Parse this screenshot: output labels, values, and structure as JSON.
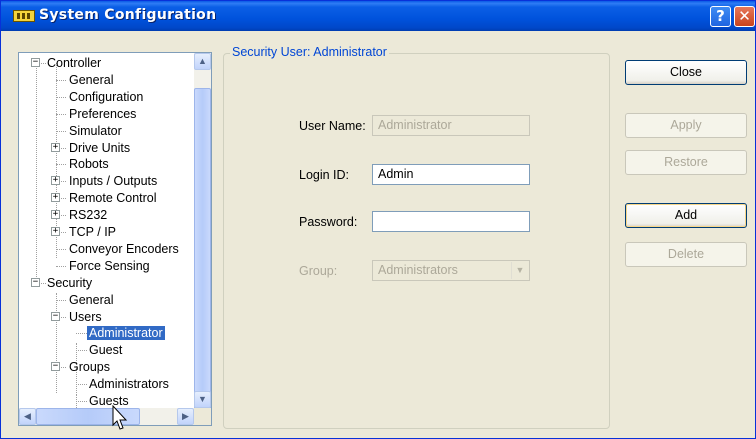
{
  "window": {
    "title": "System Configuration",
    "help_glyph": "?",
    "close_glyph": "✕"
  },
  "tree": {
    "items": [
      {
        "label": "Controller",
        "level": 0,
        "expander": "minus"
      },
      {
        "label": "General",
        "level": 1
      },
      {
        "label": "Configuration",
        "level": 1
      },
      {
        "label": "Preferences",
        "level": 1
      },
      {
        "label": "Simulator",
        "level": 1
      },
      {
        "label": "Drive Units",
        "level": 1,
        "expander": "plus"
      },
      {
        "label": "Robots",
        "level": 1
      },
      {
        "label": "Inputs / Outputs",
        "level": 1,
        "expander": "plus"
      },
      {
        "label": "Remote Control",
        "level": 1,
        "expander": "plus"
      },
      {
        "label": "RS232",
        "level": 1,
        "expander": "plus"
      },
      {
        "label": "TCP / IP",
        "level": 1,
        "expander": "plus"
      },
      {
        "label": "Conveyor Encoders",
        "level": 1
      },
      {
        "label": "Force Sensing",
        "level": 1
      },
      {
        "label": "Security",
        "level": 0,
        "expander": "minus"
      },
      {
        "label": "General",
        "level": 1
      },
      {
        "label": "Users",
        "level": 1,
        "expander": "minus"
      },
      {
        "label": "Administrator",
        "level": 2,
        "selected": true
      },
      {
        "label": "Guest",
        "level": 2
      },
      {
        "label": "Groups",
        "level": 1,
        "expander": "minus"
      },
      {
        "label": "Administrators",
        "level": 2
      },
      {
        "label": "Guests",
        "level": 2
      }
    ]
  },
  "panel": {
    "title": "Security User: Administrator",
    "user_name_label": "User Name:",
    "user_name_value": "Administrator",
    "login_id_label": "Login ID:",
    "login_id_value": "Admin",
    "password_label": "Password:",
    "password_value": "",
    "group_label": "Group:",
    "group_value": "Administrators"
  },
  "buttons": {
    "close": "Close",
    "apply": "Apply",
    "restore": "Restore",
    "add": "Add",
    "delete": "Delete"
  },
  "colors": {
    "title_bar": "#0052dc",
    "selection": "#316ac5",
    "legend_text": "#0046d5",
    "disabled_text": "#aca899"
  }
}
